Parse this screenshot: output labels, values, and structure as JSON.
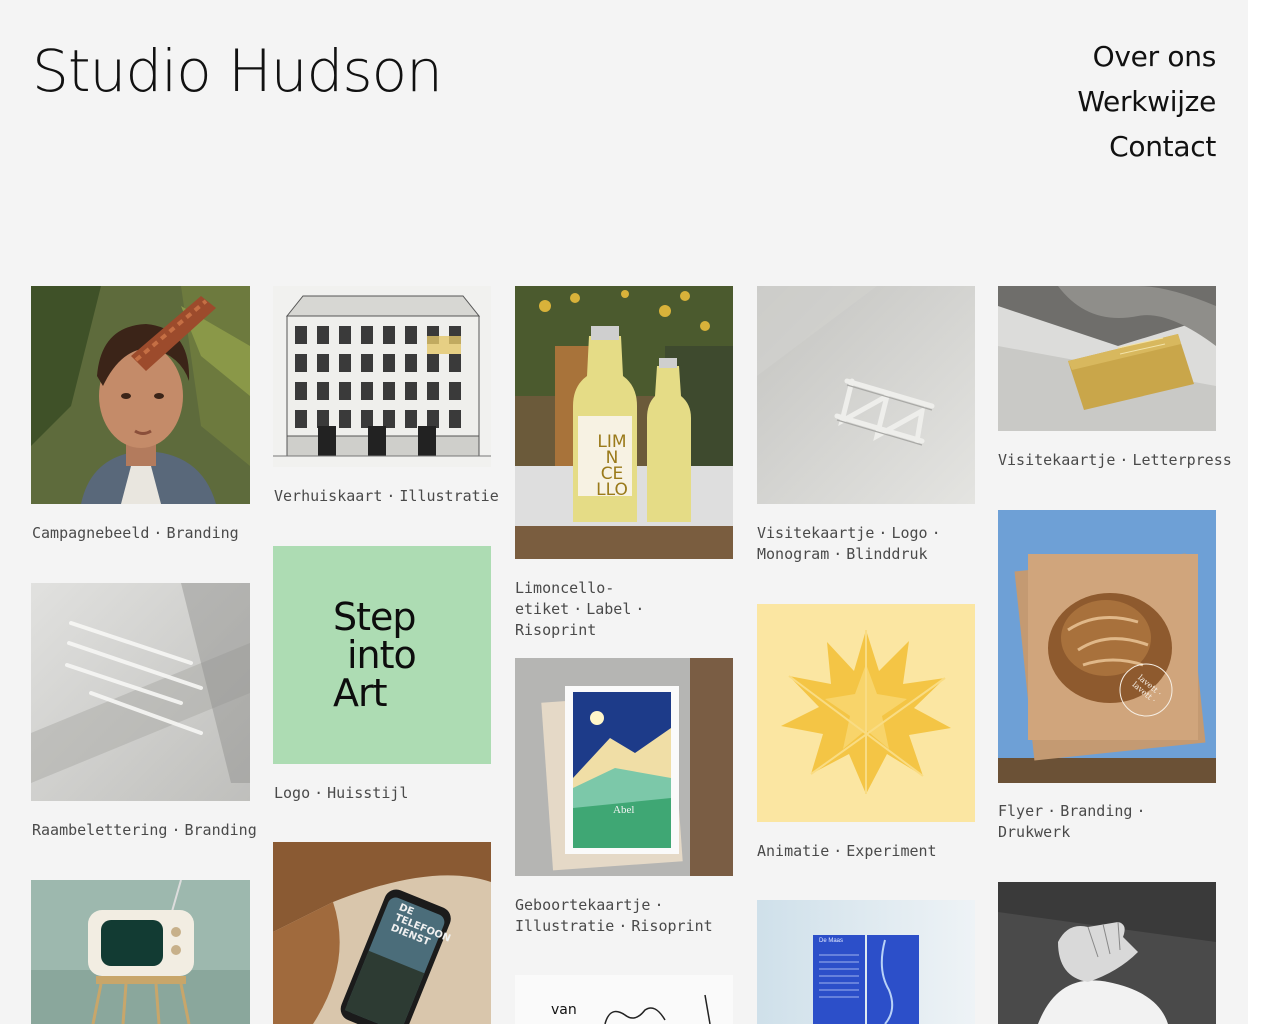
{
  "brand": {
    "name": "Studio Hudson"
  },
  "nav": {
    "items": [
      {
        "label": "Over ons"
      },
      {
        "label": "Werkwijze"
      },
      {
        "label": "Contact"
      }
    ]
  },
  "projects": [
    {
      "id": "campagnebeeld",
      "tags": [
        "Campagnebeeld",
        "Branding"
      ]
    },
    {
      "id": "raambelettering",
      "tags": [
        "Raambelettering",
        "Branding"
      ]
    },
    {
      "id": "tv",
      "tags": []
    },
    {
      "id": "verhuiskaart",
      "tags": [
        "Verhuiskaart",
        "Illustratie"
      ]
    },
    {
      "id": "logo-step",
      "tags": [
        "Logo",
        "Huisstijl"
      ],
      "logo_lines": [
        "Step",
        "into",
        "Art"
      ]
    },
    {
      "id": "phone",
      "tags": [],
      "screen_text": [
        "DE",
        "TELEFOON",
        "DIENST"
      ]
    },
    {
      "id": "limoncello",
      "tags": [
        "Limoncello-etiket",
        "Label",
        "Risoprint"
      ],
      "label_lines": [
        "LIM",
        "N",
        "CE",
        "LLO"
      ]
    },
    {
      "id": "geboortekaartje",
      "tags": [
        "Geboortekaartje",
        "Illustratie",
        "Risoprint"
      ],
      "card_name": "Abel"
    },
    {
      "id": "van",
      "tags": [],
      "word": "van"
    },
    {
      "id": "monogram",
      "tags": [
        "Visitekaartje",
        "Logo",
        "Monogram",
        "Blinddruk"
      ]
    },
    {
      "id": "animatie",
      "tags": [
        "Animatie",
        "Experiment"
      ]
    },
    {
      "id": "de-maas",
      "tags": [],
      "cover_title": "De Maas"
    },
    {
      "id": "letterpress",
      "tags": [
        "Visitekaartje",
        "Letterpress"
      ]
    },
    {
      "id": "flyer",
      "tags": [
        "Flyer",
        "Branding",
        "Drukwerk"
      ],
      "stamp": "lavett · lavett ·"
    },
    {
      "id": "hands",
      "tags": []
    }
  ],
  "colors": {
    "page_bg": "#f4f4f4",
    "text": "#111111",
    "caption": "#4a4a4a",
    "logo_green": "#addcb3",
    "star_bg": "#fbe6a2",
    "sky_blue": "#6ea0d6"
  }
}
